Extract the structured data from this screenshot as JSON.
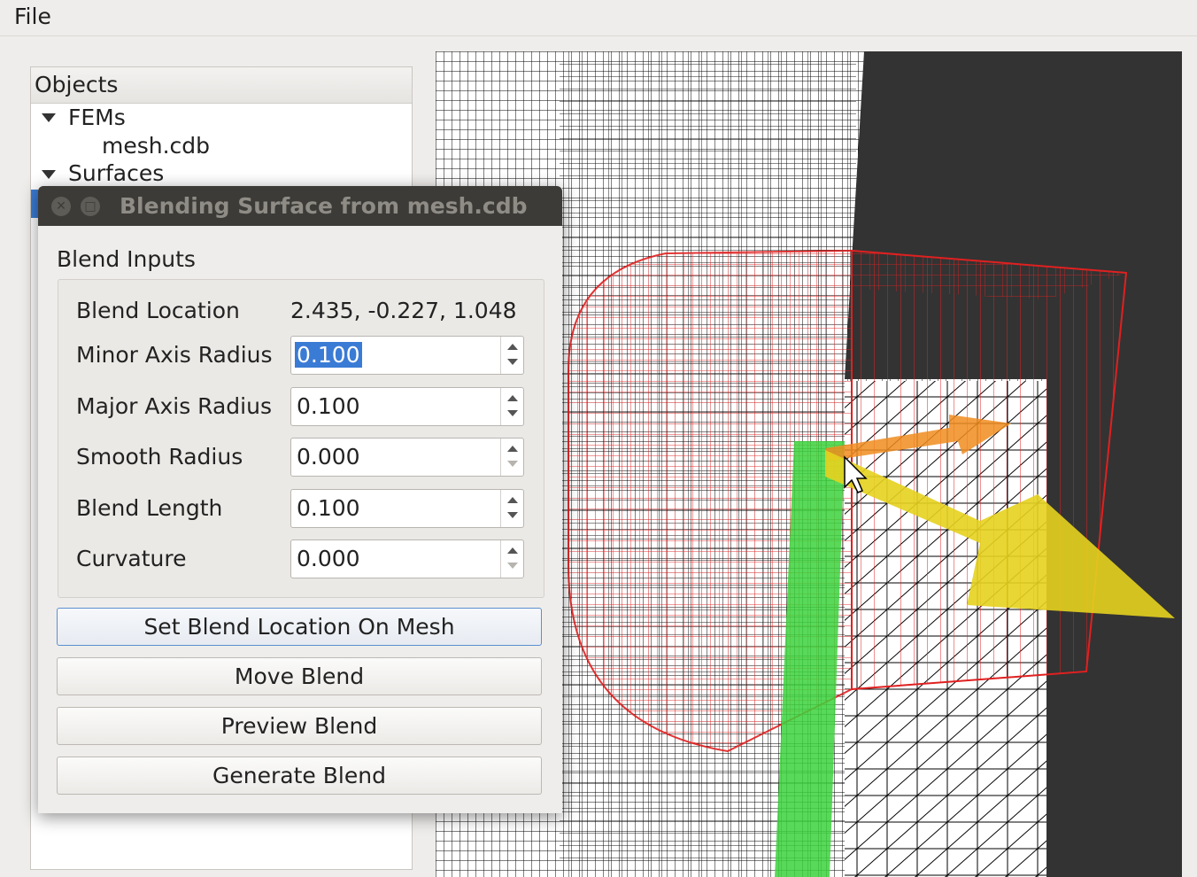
{
  "menubar": {
    "file": "File"
  },
  "objects_panel": {
    "header": "Objects",
    "items": [
      {
        "label": "FEMs",
        "expanded": true,
        "children": [
          {
            "label": "mesh.cdb"
          }
        ]
      },
      {
        "label": "Surfaces",
        "expanded": true
      }
    ]
  },
  "dialog": {
    "title": "Blending Surface from mesh.cdb",
    "group_title": "Blend Inputs",
    "blend_location": {
      "label": "Blend Location",
      "value": "2.435, -0.227, 1.048"
    },
    "fields": [
      {
        "label": "Minor Axis Radius",
        "value": "0.100",
        "selected": true
      },
      {
        "label": "Major Axis Radius",
        "value": "0.100"
      },
      {
        "label": "Smooth Radius",
        "value": "0.000"
      },
      {
        "label": "Blend Length",
        "value": "0.100"
      },
      {
        "label": "Curvature",
        "value": "0.000"
      }
    ],
    "buttons": {
      "set_location": "Set Blend Location On Mesh",
      "move": "Move Blend",
      "preview": "Preview Blend",
      "generate": "Generate Blend"
    }
  },
  "colors": {
    "window_bg": "#efedeb",
    "titlebar": "#3c3b37",
    "selection": "#3a7bd5",
    "mesh_lines": "#000000",
    "blend_wire": "#e02020",
    "dark_region": "#333333",
    "green_marker": "#3cd23c",
    "yellow_arrow": "#e6d21e",
    "orange_arrow": "#f08c1e"
  }
}
